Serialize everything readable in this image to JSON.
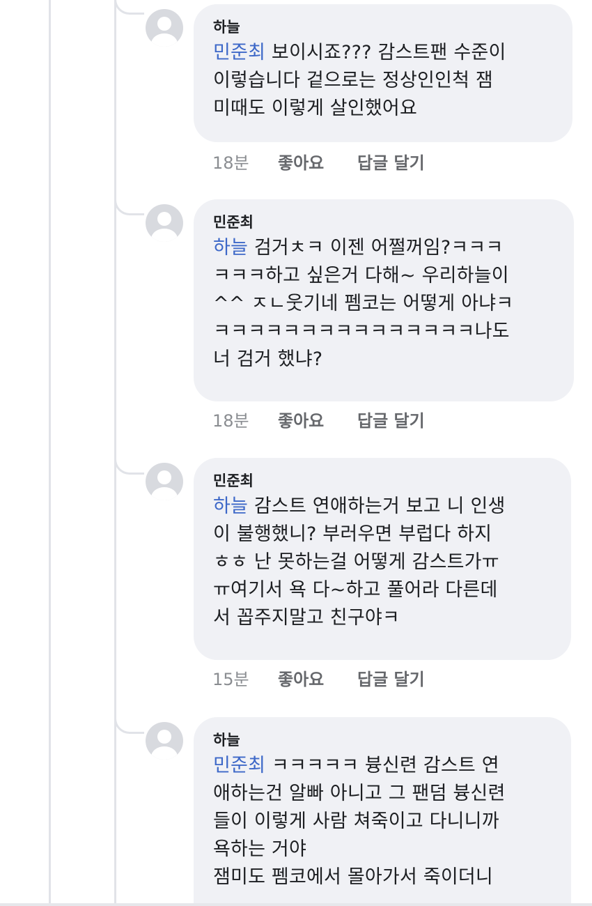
{
  "comments": [
    {
      "author": "하늘",
      "mention": "민준최",
      "text": " 보이시죠??? 감스트팬 수준이\n이렇습니다 겉으로는 정상인인척 잼\n미때도 이렇게 살인했어요",
      "time": "18분",
      "like_label": "좋아요",
      "reply_label": "답글 달기"
    },
    {
      "author": "민준최",
      "mention": "하늘",
      "text": " 검거ㅊㅋ 이젠 어쩔꺼임?ㅋㅋㅋ\nㅋㅋㅋ하고 싶은거 다해~ 우리하늘이\n^^ ㅈㄴ웃기네 펨코는 어떻게 아냐ㅋ\nㅋㅋㅋㅋㅋㅋㅋㅋㅋㅋㅋㅋㅋㅋㅋ나도\n너 검거 했냐?",
      "time": "18분",
      "like_label": "좋아요",
      "reply_label": "답글 달기"
    },
    {
      "author": "민준최",
      "mention": "하늘",
      "text": " 감스트 연애하는거 보고 니 인생\n이 불행했니? 부러우면 부럽다 하지\nㅎㅎ 난 못하는걸 어떻게 감스트가ㅠ\nㅠ여기서 욕 다~하고 풀어라 다른데\n서 꼽주지말고 친구야ㅋ",
      "time": "15분",
      "like_label": "좋아요",
      "reply_label": "답글 달기"
    },
    {
      "author": "하늘",
      "mention": "민준최",
      "text": " ㅋㅋㅋㅋㅋ 븅신련 감스트 연\n애하는건 알빠 아니고 그 팬덤 븅신련\n들이 이렇게 사람 쳐죽이고 다니니까\n욕하는 거야\n잼미도 펨코에서 몰아가서 죽이더니"
    }
  ],
  "icons": {
    "avatar": "default-profile-avatar-icon"
  },
  "colors": {
    "bubble": "#f0f1f5",
    "mention": "#3d68c8",
    "meta": "#65676b",
    "thread_line": "#e1e3e8"
  }
}
